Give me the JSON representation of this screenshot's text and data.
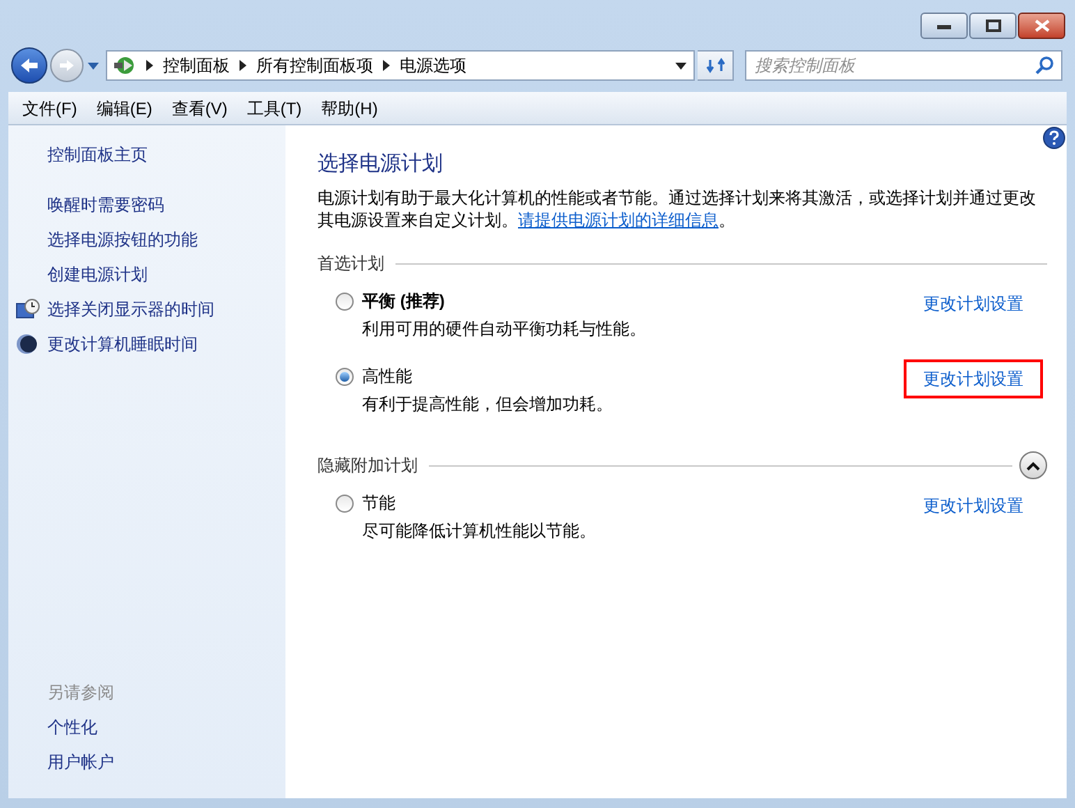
{
  "address_bar": {
    "crumbs": [
      "控制面板",
      "所有控制面板项",
      "电源选项"
    ]
  },
  "search": {
    "placeholder": "搜索控制面板"
  },
  "menu": [
    "文件(F)",
    "编辑(E)",
    "查看(V)",
    "工具(T)",
    "帮助(H)"
  ],
  "sidebar": {
    "home": "控制面板主页",
    "items": [
      {
        "label": "唤醒时需要密码",
        "kind": "plain"
      },
      {
        "label": "选择电源按钮的功能",
        "kind": "plain"
      },
      {
        "label": "创建电源计划",
        "kind": "plain"
      },
      {
        "label": "选择关闭显示器的时间",
        "kind": "display"
      },
      {
        "label": "更改计算机睡眠时间",
        "kind": "sleep"
      }
    ],
    "see_also": {
      "heading": "另请参阅",
      "links": [
        "个性化",
        "用户帐户"
      ]
    }
  },
  "main": {
    "title": "选择电源计划",
    "description_before": "电源计划有助于最大化计算机的性能或者节能。通过选择计划来将其激活，或选择计划并通过更改其电源设置来自定义计划。",
    "description_link": "请提供电源计划的详细信息",
    "description_after": "。",
    "sections": [
      {
        "heading": "首选计划",
        "plans": [
          {
            "name": "**平衡 (推荐)**",
            "description": "利用可用的硬件自动平衡功耗与性能。",
            "selected": false,
            "link": "更改计划设置",
            "highlighted": false
          },
          {
            "name": "高性能",
            "description": "有利于提高性能，但会增加功耗。",
            "selected": true,
            "link": "更改计划设置",
            "highlighted": true
          }
        ]
      },
      {
        "heading": "隐藏附加计划",
        "expanded": true,
        "plans": [
          {
            "name": "节能",
            "description": "尽可能降低计算机性能以节能。",
            "selected": false,
            "link": "更改计划设置",
            "highlighted": false
          }
        ]
      }
    ]
  }
}
